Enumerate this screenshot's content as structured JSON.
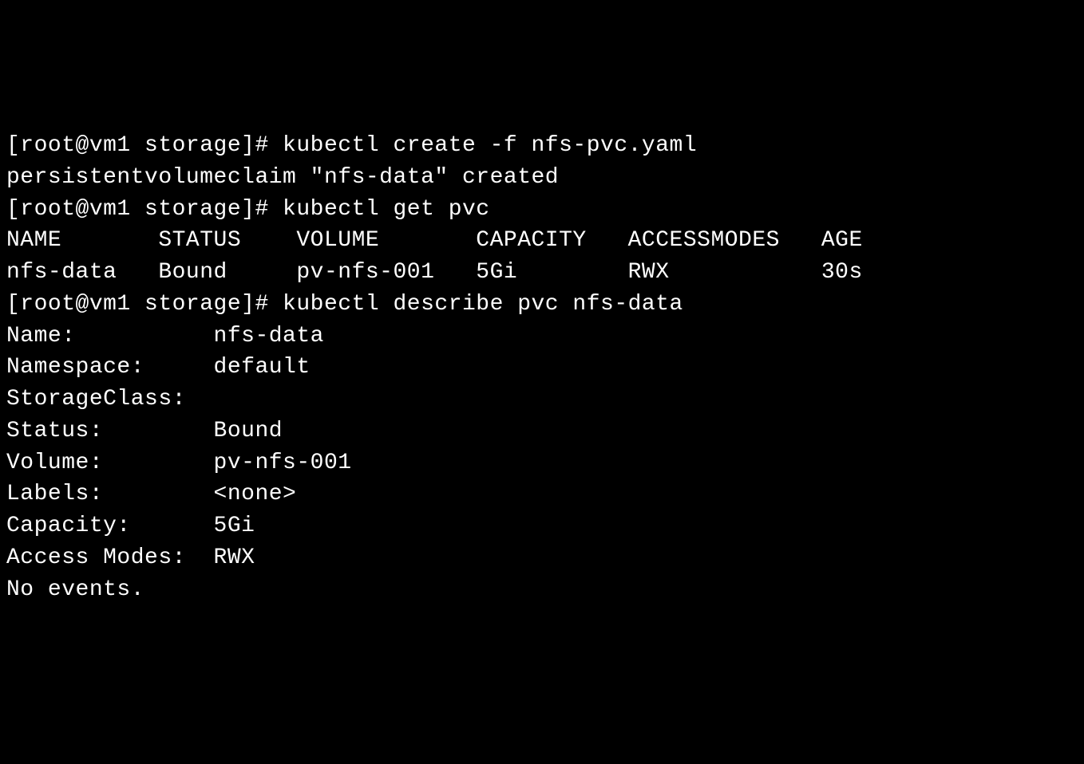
{
  "lines": {
    "l0": "[root@vm1 storage]# kubectl create -f nfs-pvc.yaml",
    "l1": "persistentvolumeclaim \"nfs-data\" created",
    "l2": "[root@vm1 storage]# kubectl get pvc",
    "l3": "NAME       STATUS    VOLUME       CAPACITY   ACCESSMODES   AGE",
    "l4": "nfs-data   Bound     pv-nfs-001   5Gi        RWX           30s",
    "l5": "[root@vm1 storage]# kubectl describe pvc nfs-data",
    "l6": "Name:          nfs-data",
    "l7": "Namespace:     default",
    "l8": "StorageClass:",
    "l9": "Status:        Bound",
    "l10": "Volume:        pv-nfs-001",
    "l11": "Labels:        <none>",
    "l12": "Capacity:      5Gi",
    "l13": "Access Modes:  RWX",
    "l14": "No events."
  }
}
